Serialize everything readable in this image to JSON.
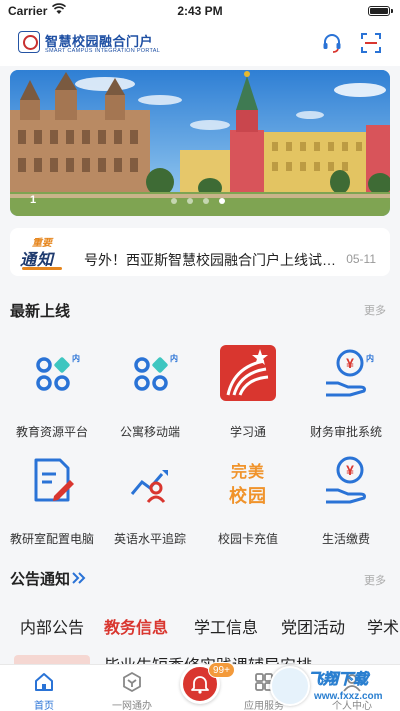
{
  "status_bar": {
    "carrier": "Carrier",
    "time": "2:43 PM"
  },
  "header": {
    "title": "智慧校园融合门户",
    "subtitle": "SMART CAMPUS INTEGRATION PORTAL"
  },
  "banner": {
    "index": "1",
    "dot_count": 4,
    "active_dot": 4
  },
  "notice": {
    "badge_top": "重要",
    "badge_bottom": "通知",
    "text": "号外！西亚斯智慧校园融合门户上线试运行",
    "date": "05-11"
  },
  "latest": {
    "title": "最新上线",
    "more": "更多",
    "apps": [
      {
        "label": "教育资源平台",
        "icon": "grid-apps-icon",
        "tag": "内"
      },
      {
        "label": "公寓移动端",
        "icon": "grid-apps-icon",
        "tag": "内"
      },
      {
        "label": "学习通",
        "icon": "xuexitong-logo-icon",
        "tag": ""
      },
      {
        "label": "财务审批系统",
        "icon": "yuan-hand-icon",
        "tag": "内"
      },
      {
        "label": "教研室配置电脑",
        "icon": "document-edit-icon",
        "tag": ""
      },
      {
        "label": "英语水平追踪",
        "icon": "person-trend-icon",
        "tag": ""
      },
      {
        "label": "校园卡充值",
        "icon": "campus-card-icon",
        "tag": ""
      },
      {
        "label": "生活缴费",
        "icon": "yuan-hand-icon",
        "tag": ""
      }
    ],
    "campus_card_text_top": "完美",
    "campus_card_text_bottom": "校园"
  },
  "announcements": {
    "title": "公告通知",
    "more": "更多",
    "tabs": [
      "内部公告",
      "教务信息",
      "学工信息",
      "党团活动",
      "学术"
    ],
    "active_tab": 1,
    "peek_text": "毕业生短季修实践课辅导安排"
  },
  "tabbar": {
    "items": [
      {
        "label": "首页",
        "icon": "home-icon"
      },
      {
        "label": "一网通办",
        "icon": "hexagon-icon"
      },
      {
        "label": "",
        "icon": "bell-icon"
      },
      {
        "label": "应用服务",
        "icon": "apps-icon"
      },
      {
        "label": "个人中心",
        "icon": "person-icon"
      }
    ],
    "active": 0,
    "badge": "99+"
  },
  "watermark": {
    "brand": "飞翔下载",
    "url": "www.fxxz.com"
  },
  "colors": {
    "accent": "#2a73d6",
    "red": "#d9362f",
    "orange": "#f39a3b"
  }
}
